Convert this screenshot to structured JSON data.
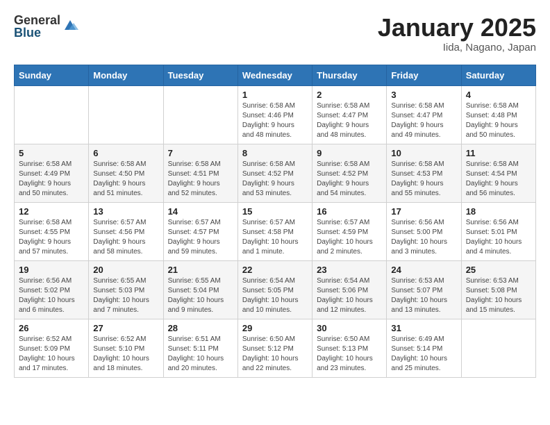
{
  "header": {
    "logo_general": "General",
    "logo_blue": "Blue",
    "title": "January 2025",
    "subtitle": "Iida, Nagano, Japan"
  },
  "weekdays": [
    "Sunday",
    "Monday",
    "Tuesday",
    "Wednesday",
    "Thursday",
    "Friday",
    "Saturday"
  ],
  "weeks": [
    [
      {
        "day": "",
        "info": ""
      },
      {
        "day": "",
        "info": ""
      },
      {
        "day": "",
        "info": ""
      },
      {
        "day": "1",
        "info": "Sunrise: 6:58 AM\nSunset: 4:46 PM\nDaylight: 9 hours\nand 48 minutes."
      },
      {
        "day": "2",
        "info": "Sunrise: 6:58 AM\nSunset: 4:47 PM\nDaylight: 9 hours\nand 48 minutes."
      },
      {
        "day": "3",
        "info": "Sunrise: 6:58 AM\nSunset: 4:47 PM\nDaylight: 9 hours\nand 49 minutes."
      },
      {
        "day": "4",
        "info": "Sunrise: 6:58 AM\nSunset: 4:48 PM\nDaylight: 9 hours\nand 50 minutes."
      }
    ],
    [
      {
        "day": "5",
        "info": "Sunrise: 6:58 AM\nSunset: 4:49 PM\nDaylight: 9 hours\nand 50 minutes."
      },
      {
        "day": "6",
        "info": "Sunrise: 6:58 AM\nSunset: 4:50 PM\nDaylight: 9 hours\nand 51 minutes."
      },
      {
        "day": "7",
        "info": "Sunrise: 6:58 AM\nSunset: 4:51 PM\nDaylight: 9 hours\nand 52 minutes."
      },
      {
        "day": "8",
        "info": "Sunrise: 6:58 AM\nSunset: 4:52 PM\nDaylight: 9 hours\nand 53 minutes."
      },
      {
        "day": "9",
        "info": "Sunrise: 6:58 AM\nSunset: 4:52 PM\nDaylight: 9 hours\nand 54 minutes."
      },
      {
        "day": "10",
        "info": "Sunrise: 6:58 AM\nSunset: 4:53 PM\nDaylight: 9 hours\nand 55 minutes."
      },
      {
        "day": "11",
        "info": "Sunrise: 6:58 AM\nSunset: 4:54 PM\nDaylight: 9 hours\nand 56 minutes."
      }
    ],
    [
      {
        "day": "12",
        "info": "Sunrise: 6:58 AM\nSunset: 4:55 PM\nDaylight: 9 hours\nand 57 minutes."
      },
      {
        "day": "13",
        "info": "Sunrise: 6:57 AM\nSunset: 4:56 PM\nDaylight: 9 hours\nand 58 minutes."
      },
      {
        "day": "14",
        "info": "Sunrise: 6:57 AM\nSunset: 4:57 PM\nDaylight: 9 hours\nand 59 minutes."
      },
      {
        "day": "15",
        "info": "Sunrise: 6:57 AM\nSunset: 4:58 PM\nDaylight: 10 hours\nand 1 minute."
      },
      {
        "day": "16",
        "info": "Sunrise: 6:57 AM\nSunset: 4:59 PM\nDaylight: 10 hours\nand 2 minutes."
      },
      {
        "day": "17",
        "info": "Sunrise: 6:56 AM\nSunset: 5:00 PM\nDaylight: 10 hours\nand 3 minutes."
      },
      {
        "day": "18",
        "info": "Sunrise: 6:56 AM\nSunset: 5:01 PM\nDaylight: 10 hours\nand 4 minutes."
      }
    ],
    [
      {
        "day": "19",
        "info": "Sunrise: 6:56 AM\nSunset: 5:02 PM\nDaylight: 10 hours\nand 6 minutes."
      },
      {
        "day": "20",
        "info": "Sunrise: 6:55 AM\nSunset: 5:03 PM\nDaylight: 10 hours\nand 7 minutes."
      },
      {
        "day": "21",
        "info": "Sunrise: 6:55 AM\nSunset: 5:04 PM\nDaylight: 10 hours\nand 9 minutes."
      },
      {
        "day": "22",
        "info": "Sunrise: 6:54 AM\nSunset: 5:05 PM\nDaylight: 10 hours\nand 10 minutes."
      },
      {
        "day": "23",
        "info": "Sunrise: 6:54 AM\nSunset: 5:06 PM\nDaylight: 10 hours\nand 12 minutes."
      },
      {
        "day": "24",
        "info": "Sunrise: 6:53 AM\nSunset: 5:07 PM\nDaylight: 10 hours\nand 13 minutes."
      },
      {
        "day": "25",
        "info": "Sunrise: 6:53 AM\nSunset: 5:08 PM\nDaylight: 10 hours\nand 15 minutes."
      }
    ],
    [
      {
        "day": "26",
        "info": "Sunrise: 6:52 AM\nSunset: 5:09 PM\nDaylight: 10 hours\nand 17 minutes."
      },
      {
        "day": "27",
        "info": "Sunrise: 6:52 AM\nSunset: 5:10 PM\nDaylight: 10 hours\nand 18 minutes."
      },
      {
        "day": "28",
        "info": "Sunrise: 6:51 AM\nSunset: 5:11 PM\nDaylight: 10 hours\nand 20 minutes."
      },
      {
        "day": "29",
        "info": "Sunrise: 6:50 AM\nSunset: 5:12 PM\nDaylight: 10 hours\nand 22 minutes."
      },
      {
        "day": "30",
        "info": "Sunrise: 6:50 AM\nSunset: 5:13 PM\nDaylight: 10 hours\nand 23 minutes."
      },
      {
        "day": "31",
        "info": "Sunrise: 6:49 AM\nSunset: 5:14 PM\nDaylight: 10 hours\nand 25 minutes."
      },
      {
        "day": "",
        "info": ""
      }
    ]
  ]
}
